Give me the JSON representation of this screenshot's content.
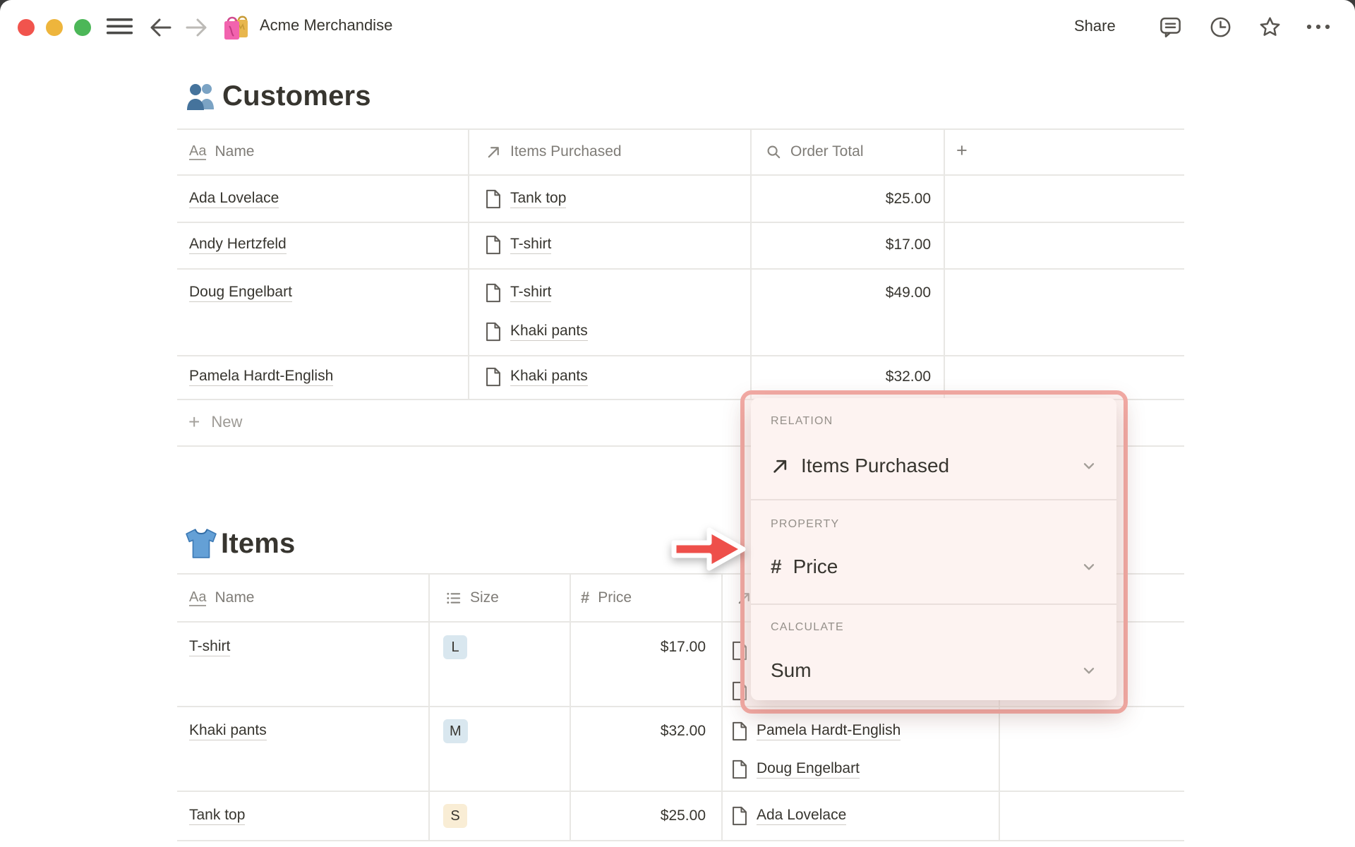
{
  "titlebar": {
    "title": "Acme Merchandise",
    "title_icon": "shopping-bags-icon",
    "share_label": "Share",
    "right_icons": [
      "comments-icon",
      "updates-clock-icon",
      "favorite-star-icon",
      "more-ellipsis-icon"
    ]
  },
  "customers_section": {
    "heading": "Customers",
    "heading_icon": "people-icon",
    "columns": [
      {
        "label": "Name",
        "icon": "text-property-icon"
      },
      {
        "label": "Items Purchased",
        "icon": "relation-arrow-icon"
      },
      {
        "label": "Order Total",
        "icon": "rollup-search-icon"
      },
      {
        "label": "+",
        "icon": "plus-icon"
      }
    ],
    "rows": [
      {
        "name": "Ada Lovelace",
        "items": [
          "Tank top"
        ],
        "order_total": "$25.00"
      },
      {
        "name": "Andy Hertzfeld",
        "items": [
          "T-shirt"
        ],
        "order_total": "$17.00"
      },
      {
        "name": "Doug Engelbart",
        "items": [
          "T-shirt",
          "Khaki pants"
        ],
        "order_total": "$49.00"
      },
      {
        "name": "Pamela Hardt-English",
        "items": [
          "Khaki pants"
        ],
        "order_total": "$32.00"
      }
    ],
    "new_row_label": "New"
  },
  "items_section": {
    "heading": "Items",
    "heading_icon": "tshirt-icon",
    "columns": [
      {
        "label": "Name",
        "icon": "text-property-icon"
      },
      {
        "label": "Size",
        "icon": "select-list-icon"
      },
      {
        "label": "Price",
        "icon": "hash-icon"
      },
      {
        "label": "",
        "icon": "relation-arrow-icon"
      }
    ],
    "rows": [
      {
        "name": "T-shirt",
        "size": "L",
        "size_color": "blue",
        "price": "$17.00",
        "customers": [],
        "hidden_customer_chips": 2
      },
      {
        "name": "Khaki pants",
        "size": "M",
        "size_color": "blue",
        "price": "$32.00",
        "customers": [
          "Pamela Hardt-English",
          "Doug Engelbart"
        ]
      },
      {
        "name": "Tank top",
        "size": "S",
        "size_color": "yellow",
        "price": "$25.00",
        "customers": [
          "Ada Lovelace"
        ]
      }
    ]
  },
  "popup": {
    "sections": [
      {
        "label": "RELATION",
        "value": "Items Purchased",
        "icon": "relation-arrow-icon"
      },
      {
        "label": "PROPERTY",
        "value": "Price",
        "icon": "hash-icon"
      },
      {
        "label": "CALCULATE",
        "value": "Sum",
        "icon": ""
      }
    ]
  },
  "icons": {
    "text_property_glyph": "Aa",
    "hash_glyph": "#",
    "plus_glyph": "+"
  },
  "colors": {
    "popup_border": "#f1a9a3",
    "popup_panel_bg": "#fdf3f1",
    "annotation_arrow_red": "#ee4f4a",
    "tag_blue_bg": "#d9e7ef",
    "tag_yellow_bg": "#f9edd5",
    "traffic_red": "#f1544d",
    "traffic_yellow": "#eeb53c",
    "traffic_green": "#4cb758",
    "grid_line": "#e8e7e4",
    "text_primary": "#37352f",
    "text_secondary": "#7f7c77"
  }
}
